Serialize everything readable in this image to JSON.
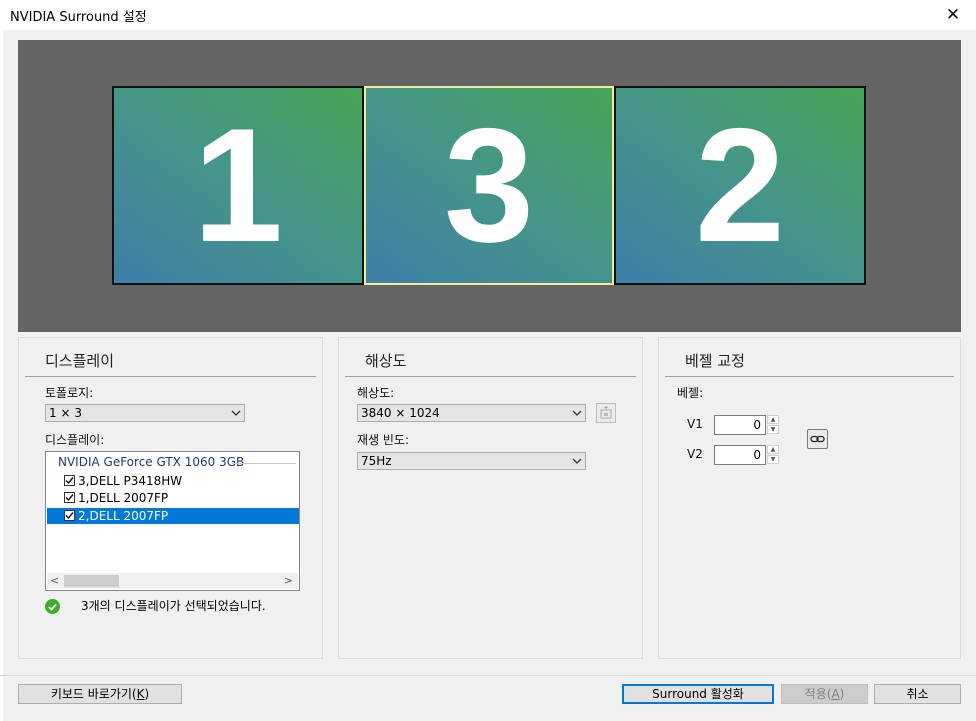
{
  "window": {
    "title": "NVIDIA Surround 설정"
  },
  "monitors": [
    {
      "label": "1",
      "selected": false
    },
    {
      "label": "3",
      "selected": true
    },
    {
      "label": "2",
      "selected": false
    }
  ],
  "display_panel": {
    "heading": "디스플레이",
    "topology_label": "토폴로지:",
    "topology_value": "1 × 3",
    "displays_label": "디스플레이:",
    "gpu_name": "NVIDIA GeForce GTX 1060 3GB",
    "displays": [
      {
        "label": "3,DELL P3418HW",
        "checked": true,
        "selected": false
      },
      {
        "label": "1,DELL 2007FP",
        "checked": true,
        "selected": false
      },
      {
        "label": "2,DELL 2007FP",
        "checked": true,
        "selected": true
      }
    ],
    "status": "3개의 디스플레이가 선택되었습니다."
  },
  "resolution_panel": {
    "heading": "해상도",
    "resolution_label": "해상도:",
    "resolution_value": "3840 × 1024",
    "refresh_label": "재생 빈도:",
    "refresh_value": "75Hz"
  },
  "bezel_panel": {
    "heading": "베젤 교정",
    "bezel_label": "베젤:",
    "v1_label": "V1",
    "v1_value": "0",
    "v2_label": "V2",
    "v2_value": "0"
  },
  "footer": {
    "keyboard_btn": "키보드 바로가기",
    "keyboard_key": "K",
    "enable_btn": "Surround 활성화",
    "apply_btn": "적용",
    "apply_key": "A",
    "cancel_btn": "취소"
  }
}
